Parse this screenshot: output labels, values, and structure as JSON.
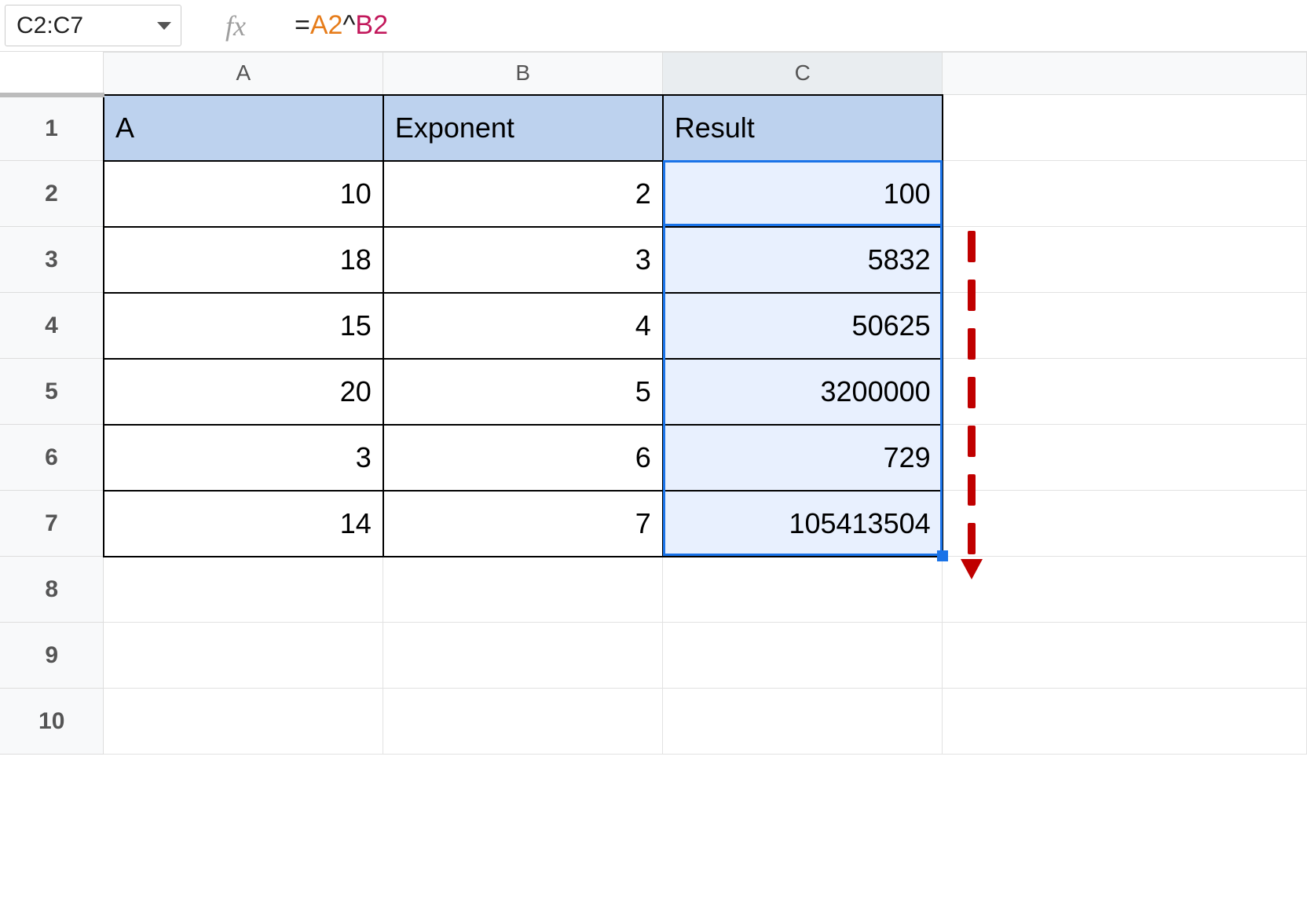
{
  "namebox": {
    "value": "C2:C7"
  },
  "fx_label": "fx",
  "formula": {
    "eq": "=",
    "ref1": "A2",
    "op": "^",
    "ref2": "B2"
  },
  "columns": [
    "A",
    "B",
    "C"
  ],
  "row_numbers": [
    "1",
    "2",
    "3",
    "4",
    "5",
    "6",
    "7",
    "8",
    "9",
    "10"
  ],
  "headers": {
    "a": "A",
    "b": "Exponent",
    "c": "Result"
  },
  "rows": [
    {
      "a": "10",
      "b": "2",
      "c": "100"
    },
    {
      "a": "18",
      "b": "3",
      "c": "5832"
    },
    {
      "a": "15",
      "b": "4",
      "c": "50625"
    },
    {
      "a": "20",
      "b": "5",
      "c": "3200000"
    },
    {
      "a": "3",
      "b": "6",
      "c": "729"
    },
    {
      "a": "14",
      "b": "7",
      "c": "105413504"
    }
  ],
  "chart_data": {
    "type": "table",
    "title": "",
    "columns": [
      "A",
      "Exponent",
      "Result"
    ],
    "rows": [
      [
        10,
        2,
        100
      ],
      [
        18,
        3,
        5832
      ],
      [
        15,
        4,
        50625
      ],
      [
        20,
        5,
        3200000
      ],
      [
        3,
        6,
        729
      ],
      [
        14,
        7,
        105413504
      ]
    ],
    "formula": "=A2^B2",
    "selection": "C2:C7"
  }
}
